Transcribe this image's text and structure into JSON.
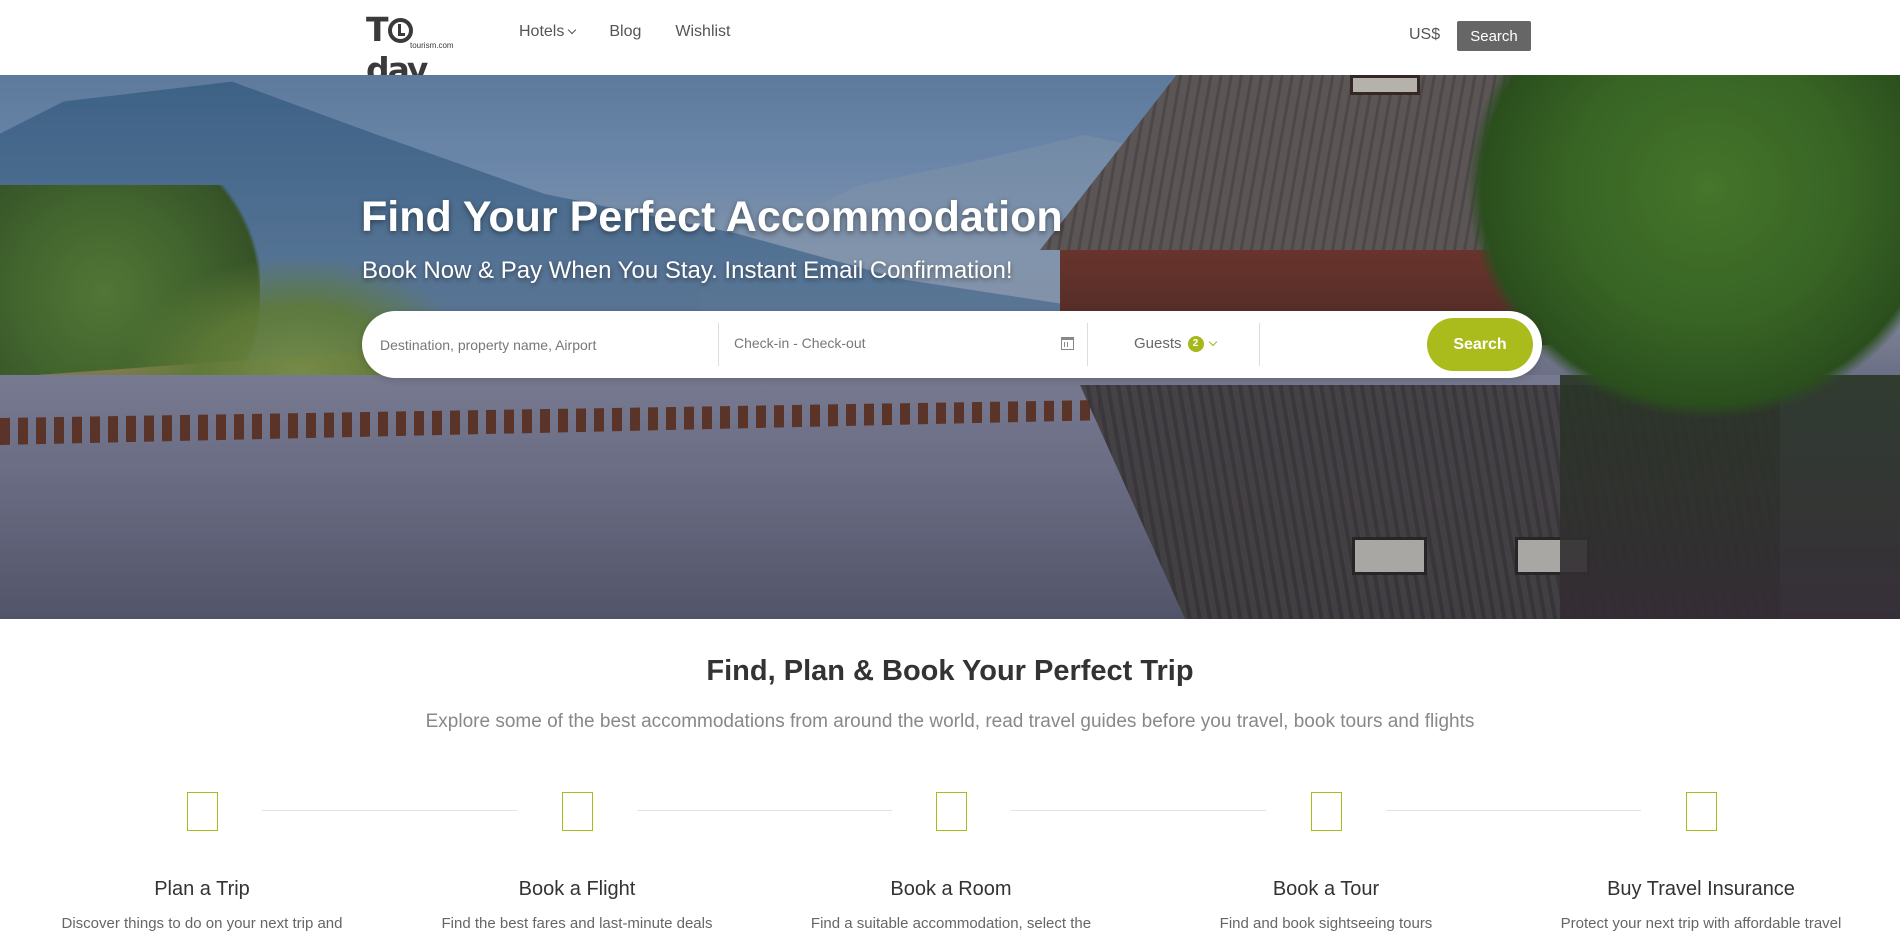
{
  "header": {
    "logo_text": "Today",
    "logo_subtext": "tourism.com",
    "nav": [
      {
        "label": "Hotels",
        "has_dropdown": true
      },
      {
        "label": "Blog",
        "has_dropdown": false
      },
      {
        "label": "Wishlist",
        "has_dropdown": false
      }
    ],
    "currency": "US$",
    "search_label": "Search"
  },
  "hero": {
    "title": "Find Your Perfect Accommodation",
    "subtitle": "Book Now & Pay When You Stay. Instant Email Confirmation!",
    "search": {
      "destination_placeholder": "Destination, property name, Airport",
      "dates_placeholder": "Check-in - Check-out",
      "guests_label": "Guests",
      "guests_count": "2",
      "button_label": "Search"
    }
  },
  "features_section": {
    "title": "Find, Plan & Book Your Perfect Trip",
    "subtitle": "Explore some of the best accommodations from around the world, read travel guides before you travel, book tours and flights",
    "items": [
      {
        "title": "Plan a Trip",
        "desc": "Discover things to do on your next trip and"
      },
      {
        "title": "Book a Flight",
        "desc": "Find the best fares and last-minute deals"
      },
      {
        "title": "Book a Room",
        "desc": "Find a suitable accommodation, select the"
      },
      {
        "title": "Book a Tour",
        "desc": "Find and book sightseeing tours"
      },
      {
        "title": "Buy Travel Insurance",
        "desc": "Protect your next trip with affordable travel"
      }
    ]
  },
  "colors": {
    "accent": "#a9bc1c",
    "header_search_bg": "#666666"
  }
}
